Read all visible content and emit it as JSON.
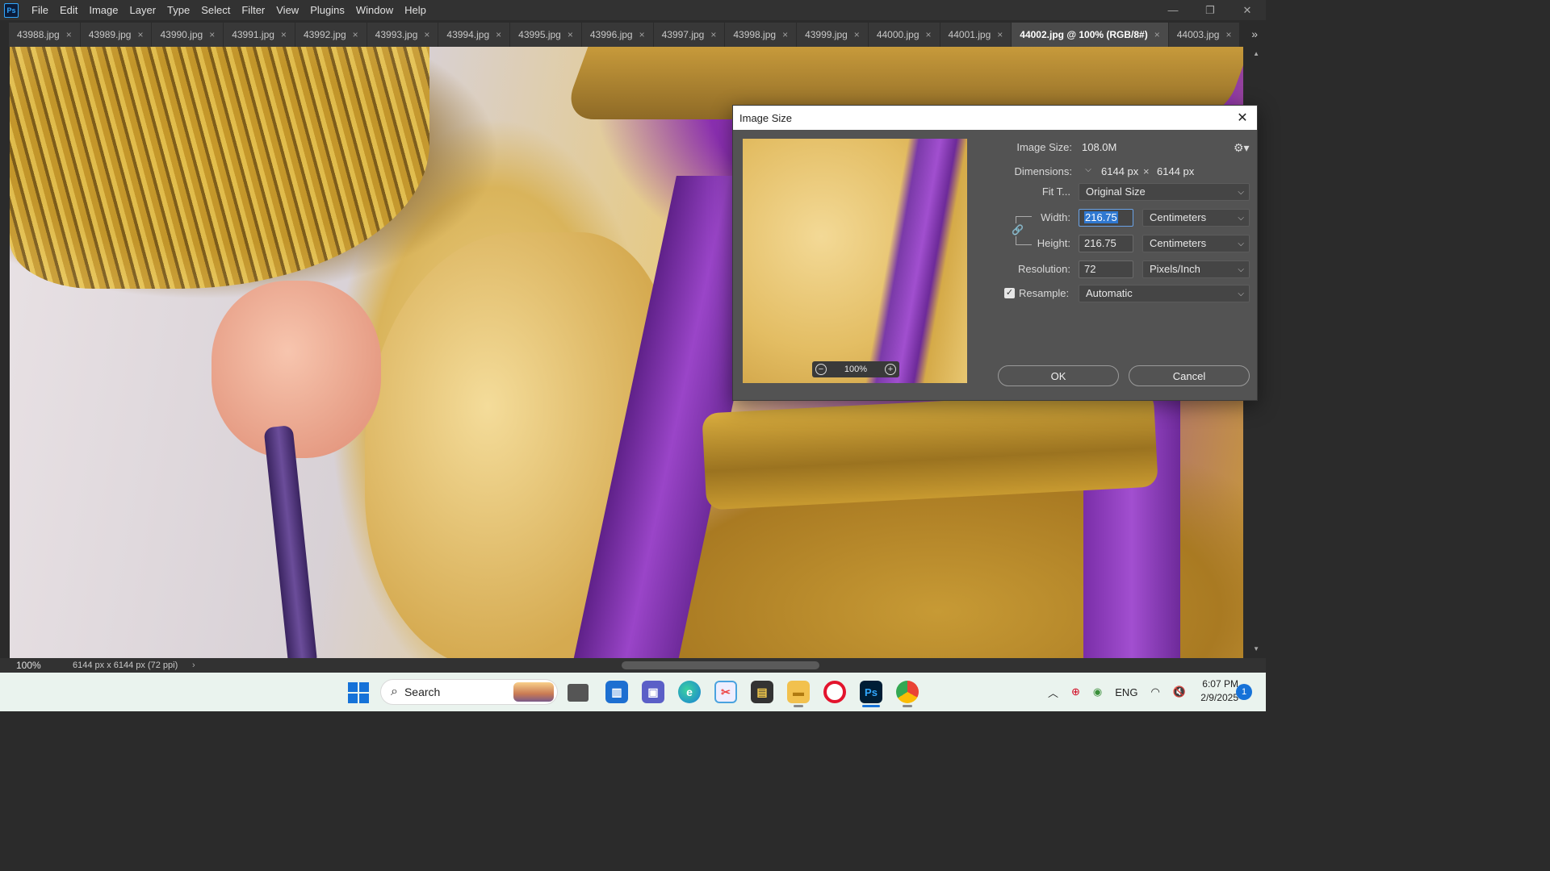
{
  "app": {
    "logo": "Ps",
    "menu": [
      "File",
      "Edit",
      "Image",
      "Layer",
      "Type",
      "Select",
      "Filter",
      "View",
      "Plugins",
      "Window",
      "Help"
    ],
    "window_controls": {
      "minimize": "—",
      "restore": "❐",
      "close": "✕"
    }
  },
  "tabs": [
    {
      "label": "43988.jpg",
      "active": false
    },
    {
      "label": "43989.jpg",
      "active": false
    },
    {
      "label": "43990.jpg",
      "active": false
    },
    {
      "label": "43991.jpg",
      "active": false
    },
    {
      "label": "43992.jpg",
      "active": false
    },
    {
      "label": "43993.jpg",
      "active": false
    },
    {
      "label": "43994.jpg",
      "active": false
    },
    {
      "label": "43995.jpg",
      "active": false
    },
    {
      "label": "43996.jpg",
      "active": false
    },
    {
      "label": "43997.jpg",
      "active": false
    },
    {
      "label": "43998.jpg",
      "active": false
    },
    {
      "label": "43999.jpg",
      "active": false
    },
    {
      "label": "44000.jpg",
      "active": false
    },
    {
      "label": "44001.jpg",
      "active": false
    },
    {
      "label": "44002.jpg @ 100% (RGB/8#)",
      "active": true
    },
    {
      "label": "44003.jpg",
      "active": false
    }
  ],
  "tab_close_glyph": "×",
  "tab_overflow_glyph": "»",
  "status": {
    "zoom": "100%",
    "doc_info": "6144 px x 6144 px (72 ppi)",
    "arrow": "›"
  },
  "dialog": {
    "title": "Image Size",
    "close_glyph": "✕",
    "preview_zoom": "100%",
    "zoom_out_glyph": "−",
    "zoom_in_glyph": "+",
    "image_size_label": "Image Size:",
    "image_size_value": "108.0M",
    "dimensions_label": "Dimensions:",
    "dim_width": "6144 px",
    "dim_sep": "×",
    "dim_height": "6144 px",
    "fit_label": "Fit T...",
    "fit_value": "Original Size",
    "width_label": "Width:",
    "width_value": "216.75",
    "width_unit": "Centimeters",
    "height_label": "Height:",
    "height_value": "216.75",
    "height_unit": "Centimeters",
    "resolution_label": "Resolution:",
    "resolution_value": "72",
    "resolution_unit": "Pixels/Inch",
    "resample_label": "Resample:",
    "resample_checked": true,
    "resample_value": "Automatic",
    "ok_label": "OK",
    "cancel_label": "Cancel"
  },
  "taskbar": {
    "search_label": "Search",
    "tray": {
      "language": "ENG"
    },
    "clock_time": "6:07 PM",
    "clock_date": "2/9/2025",
    "notification_count": "1"
  },
  "colors": {
    "accent_blue": "#1672d8",
    "ps_blue": "#31a8ff",
    "dialog_bg": "#535353"
  }
}
